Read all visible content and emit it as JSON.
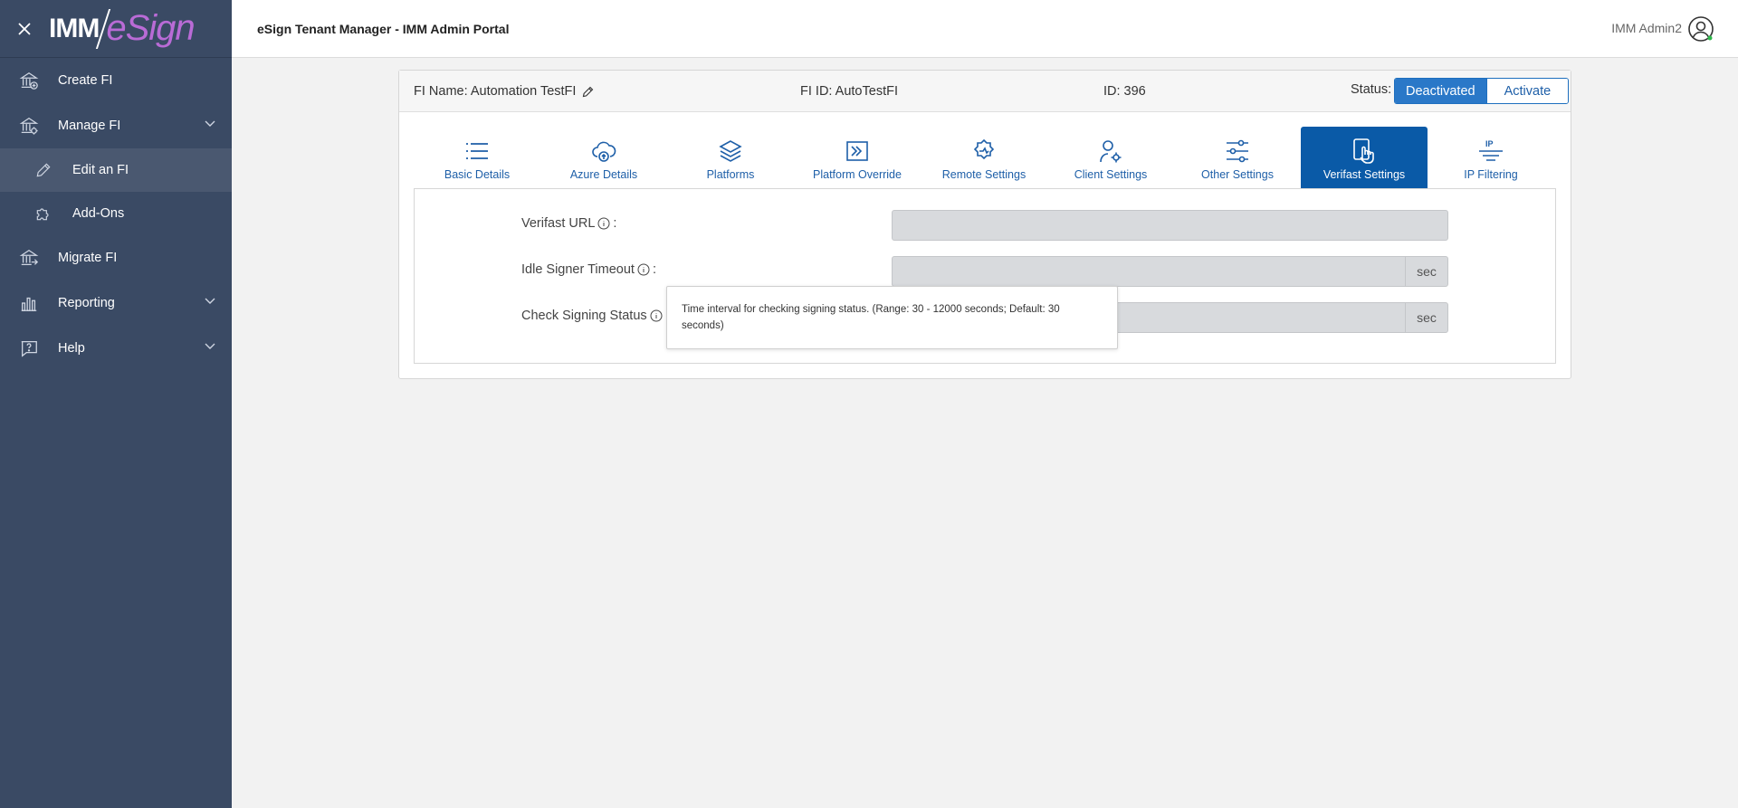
{
  "sidebar": {
    "logo": {
      "imm": "IMM",
      "esign": "eSign"
    },
    "items": [
      {
        "label": "Create FI",
        "icon": "bank-plus-icon"
      },
      {
        "label": "Manage FI",
        "icon": "bank-gear-icon",
        "expandable": true
      },
      {
        "label": "Edit an FI",
        "icon": "pencil-icon",
        "sub": true,
        "active": true
      },
      {
        "label": "Add-Ons",
        "icon": "puzzle-icon",
        "sub": true
      },
      {
        "label": "Migrate FI",
        "icon": "bank-arrow-icon"
      },
      {
        "label": "Reporting",
        "icon": "bar-chart-icon",
        "expandable": true
      },
      {
        "label": "Help",
        "icon": "help-bubble-icon",
        "expandable": true
      }
    ]
  },
  "header": {
    "title": "eSign Tenant Manager - IMM Admin Portal",
    "user": "IMM Admin2"
  },
  "fi": {
    "name_label": "FI Name: Automation TestFI",
    "fi_id_label": "FI ID: AutoTestFI",
    "id_label": "ID: 396",
    "status_label": "Status:",
    "status_on": "Deactivated",
    "status_off": "Activate"
  },
  "tabs": [
    {
      "label": "Basic Details",
      "icon": "list-icon"
    },
    {
      "label": "Azure Details",
      "icon": "cloud-upload-icon"
    },
    {
      "label": "Platforms",
      "icon": "layers-icon"
    },
    {
      "label": "Platform Override",
      "icon": "arrow-in-box-icon"
    },
    {
      "label": "Remote Settings",
      "icon": "remote-gear-icon"
    },
    {
      "label": "Client Settings",
      "icon": "user-gear-icon"
    },
    {
      "label": "Other Settings",
      "icon": "sliders-icon"
    },
    {
      "label": "Verifast Settings",
      "icon": "touch-device-icon",
      "active": true
    },
    {
      "label": "IP Filtering",
      "icon": "ip-filter-icon"
    }
  ],
  "form": {
    "verifast_url": {
      "label": "Verifast URL",
      "colon": ":",
      "value": ""
    },
    "idle_timeout": {
      "label": "Idle Signer Timeout",
      "colon": ":",
      "value": "",
      "unit": "sec"
    },
    "check_status": {
      "label": "Check Signing Status",
      "value": "",
      "unit": "sec"
    }
  },
  "tooltip": {
    "text": "Time interval for checking signing status. (Range: 30 - 12000 seconds; Default: 30 seconds)"
  },
  "colors": {
    "sidebar_bg": "#3a4a64",
    "accent": "#0a5aa7",
    "field_bg": "#d8dadd"
  }
}
